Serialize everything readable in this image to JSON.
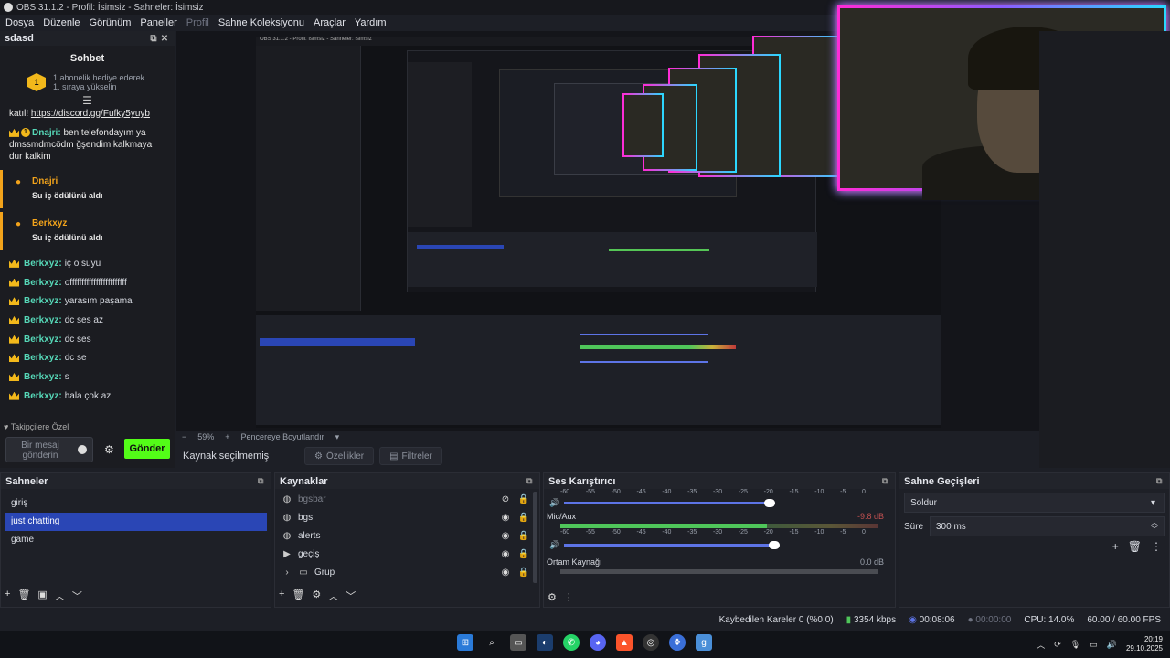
{
  "window": {
    "title": "OBS 31.1.2 - Profil: İsimsiz - Sahneler: İsimsiz"
  },
  "menu": [
    "Dosya",
    "Düzenle",
    "Görünüm",
    "Paneller",
    "Profil",
    "Sahne Koleksiyonu",
    "Araçlar",
    "Yardım"
  ],
  "chat": {
    "dock_title": "sdasd",
    "title": "Sohbet",
    "gift_line1": "1 abonelik hediye ederek",
    "gift_line2": "1. sıraya yükselin",
    "gift_badge": "1",
    "discord_prefix": "katıl! ",
    "discord_link": "https://discord.gg/Fufky5yuyb",
    "msg1_user": "Dnajri:",
    "msg1_text": " ben telefondayım ya dmssmdmcödm ğşendim kalkmaya dur kalkim",
    "redeem1_user": "Dnajri",
    "redeem1_text": "Su iç ödülünü aldı",
    "redeem2_user": "Berkxyz",
    "redeem2_text": "Su iç ödülünü aldı",
    "messages": [
      {
        "user": "Berkxyz:",
        "text": "iç o suyu"
      },
      {
        "user": "Berkxyz:",
        "text": "offffffffffffffffffffffff"
      },
      {
        "user": "Berkxyz:",
        "text": "yarasım paşama"
      },
      {
        "user": "Berkxyz:",
        "text": "dc ses az"
      },
      {
        "user": "Berkxyz:",
        "text": "dc ses"
      },
      {
        "user": "Berkxyz:",
        "text": "dc se"
      },
      {
        "user": "Berkxyz:",
        "text": "s"
      },
      {
        "user": "Berkxyz:",
        "text": "hala çok az"
      }
    ],
    "privacy_label": "Takipçilere Özel",
    "input_placeholder": "Bir mesaj gönderin",
    "send_label": "Gönder",
    "send_color": "#53fc18"
  },
  "preview": {
    "zoom": "59%",
    "zoom_mode": "Pencereye Boyutlandır",
    "nested_title": "OBS 31.1.2 - Profil: İsimsiz - Sahneler: İsimsiz"
  },
  "context": {
    "no_source": "Kaynak seçilmemiş",
    "properties": "Özellikler",
    "filters": "Filtreler"
  },
  "scenes": {
    "title": "Sahneler",
    "items": [
      "giriş",
      "just chatting",
      "game"
    ],
    "selected": "just chatting"
  },
  "sources": {
    "title": "Kaynaklar",
    "items": [
      {
        "name": "bgsbar",
        "icon": "globe-icon",
        "hidden": true
      },
      {
        "name": "bgs",
        "icon": "globe-icon",
        "hidden": false
      },
      {
        "name": "alerts",
        "icon": "globe-icon",
        "hidden": false
      },
      {
        "name": "geçiş",
        "icon": "play-icon",
        "hidden": false
      },
      {
        "name": "Grup",
        "icon": "folder-icon",
        "hidden": false
      }
    ]
  },
  "mixer": {
    "title": "Ses Karıştırıcı",
    "scale": [
      "-60",
      "-55",
      "-50",
      "-45",
      "-40",
      "-35",
      "-30",
      "-25",
      "-20",
      "-15",
      "-10",
      "-5",
      "0"
    ],
    "channels": [
      {
        "name": "Mic/Aux",
        "db": "-9.8 dB"
      },
      {
        "name": "Ortam Kaynağı",
        "db": "0.0 dB"
      }
    ]
  },
  "transitions": {
    "title": "Sahne Geçişleri",
    "type": "Soldur",
    "duration_label": "Süre",
    "duration": "300 ms"
  },
  "status": {
    "dropped": "Kaybedilen Kareler 0 (%0.0)",
    "bitrate": "3354 kbps",
    "stream_time": "00:08:06",
    "rec_time": "00:00:00",
    "cpu": "CPU: 14.0%",
    "fps": "60.00 / 60.00 FPS"
  },
  "taskbar": {
    "time": "20:19",
    "date": "29.10.2025"
  }
}
